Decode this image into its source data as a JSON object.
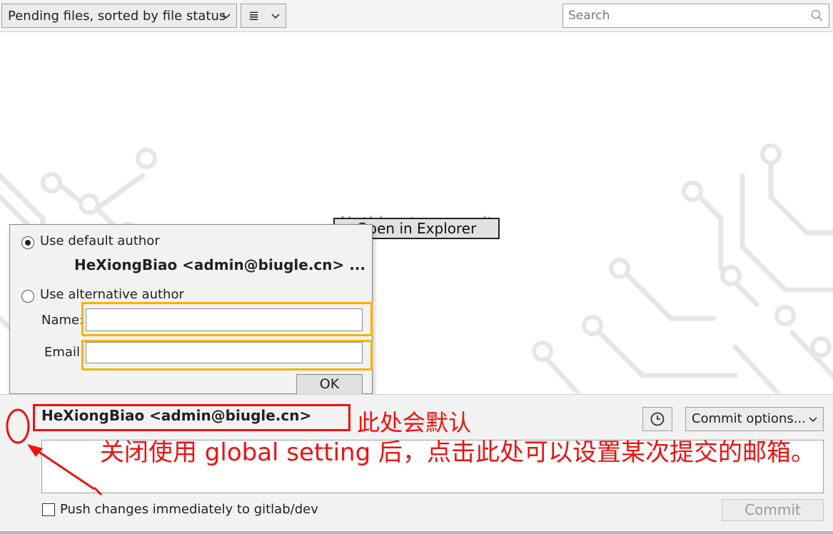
{
  "toolbar": {
    "sort_label": "Pending files, sorted by file status",
    "view_icon_glyph": "≣",
    "chevron_glyph": "⌄",
    "search_placeholder": "Search"
  },
  "main": {
    "empty_text": "Nothing to commit",
    "open_explorer_label": "Open in Explorer"
  },
  "author_popup": {
    "use_default_label": "Use default author",
    "default_author": "HeXiongBiao <admin@biugle.cn>  ...",
    "use_alternative_label": "Use alternative author",
    "name_label": "Name:",
    "email_label": "Email:",
    "name_value": "",
    "email_value": "",
    "ok_label": "OK",
    "selected": "default"
  },
  "commit_area": {
    "author": "HeXiongBiao <admin@biugle.cn>",
    "commit_options_label": "Commit options...",
    "message": "",
    "push_label": "Push changes immediately to gitlab/dev",
    "push_checked": false,
    "commit_label": "Commit"
  },
  "annotations": {
    "hint_default": "此处会默认",
    "hint_click": "关闭使用 global setting 后，点击此处可以设置某次提交的邮箱。"
  },
  "colors": {
    "annotation_red": "#ee1111",
    "highlight_yellow": "#f4b400",
    "circuit_gray": "#e8e8e8"
  }
}
